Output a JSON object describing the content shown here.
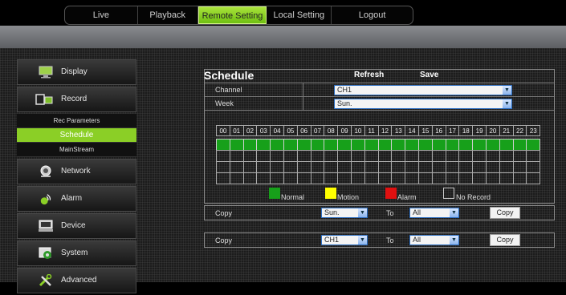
{
  "nav": {
    "tabs": [
      {
        "label": "Live"
      },
      {
        "label": "Playback"
      },
      {
        "label": "Remote Setting"
      },
      {
        "label": "Local Setting"
      },
      {
        "label": "Logout"
      }
    ],
    "active_tab": "Remote Setting"
  },
  "sidebar": {
    "items": [
      {
        "label": "Display",
        "icon": "monitor-icon"
      },
      {
        "label": "Record",
        "icon": "record-icon"
      },
      {
        "label": "Network",
        "icon": "network-icon"
      },
      {
        "label": "Alarm",
        "icon": "alarm-icon"
      },
      {
        "label": "Device",
        "icon": "device-icon"
      },
      {
        "label": "System",
        "icon": "system-icon"
      },
      {
        "label": "Advanced",
        "icon": "tools-icon"
      }
    ],
    "record_sub": [
      {
        "label": "Rec Parameters"
      },
      {
        "label": "Schedule"
      },
      {
        "label": "MainStream"
      }
    ],
    "active_sub": "Schedule"
  },
  "panel": {
    "title": "Schedule",
    "refresh_label": "Refresh",
    "save_label": "Save",
    "channel_label": "Channel",
    "channel_value": "CH1",
    "week_label": "Week",
    "week_value": "Sun.",
    "hours": [
      "00",
      "01",
      "02",
      "03",
      "04",
      "05",
      "06",
      "07",
      "08",
      "09",
      "10",
      "11",
      "12",
      "13",
      "14",
      "15",
      "16",
      "17",
      "18",
      "19",
      "20",
      "21",
      "22",
      "23"
    ],
    "schedule_rows": [
      {
        "type": "Normal",
        "hours_on": [
          0,
          1,
          2,
          3,
          4,
          5,
          6,
          7,
          8,
          9,
          10,
          11,
          12,
          13,
          14,
          15,
          16,
          17,
          18,
          19,
          20,
          21,
          22,
          23
        ]
      },
      {
        "type": "Motion",
        "hours_on": []
      },
      {
        "type": "Alarm",
        "hours_on": []
      }
    ],
    "legend": [
      {
        "label": "Normal",
        "color": "#17a01a"
      },
      {
        "label": "Motion",
        "color": "#ffff00"
      },
      {
        "label": "Alarm",
        "color": "#e01010"
      },
      {
        "label": "No Record",
        "color": "transparent"
      }
    ],
    "copy_week": {
      "label": "Copy",
      "from": "Sun.",
      "to_label": "To",
      "to": "All",
      "button": "Copy"
    },
    "copy_channel": {
      "label": "Copy",
      "from": "CH1",
      "to_label": "To",
      "to": "All",
      "button": "Copy"
    }
  },
  "colors": {
    "accent": "#8bcf26",
    "record_normal": "#17a01a"
  }
}
